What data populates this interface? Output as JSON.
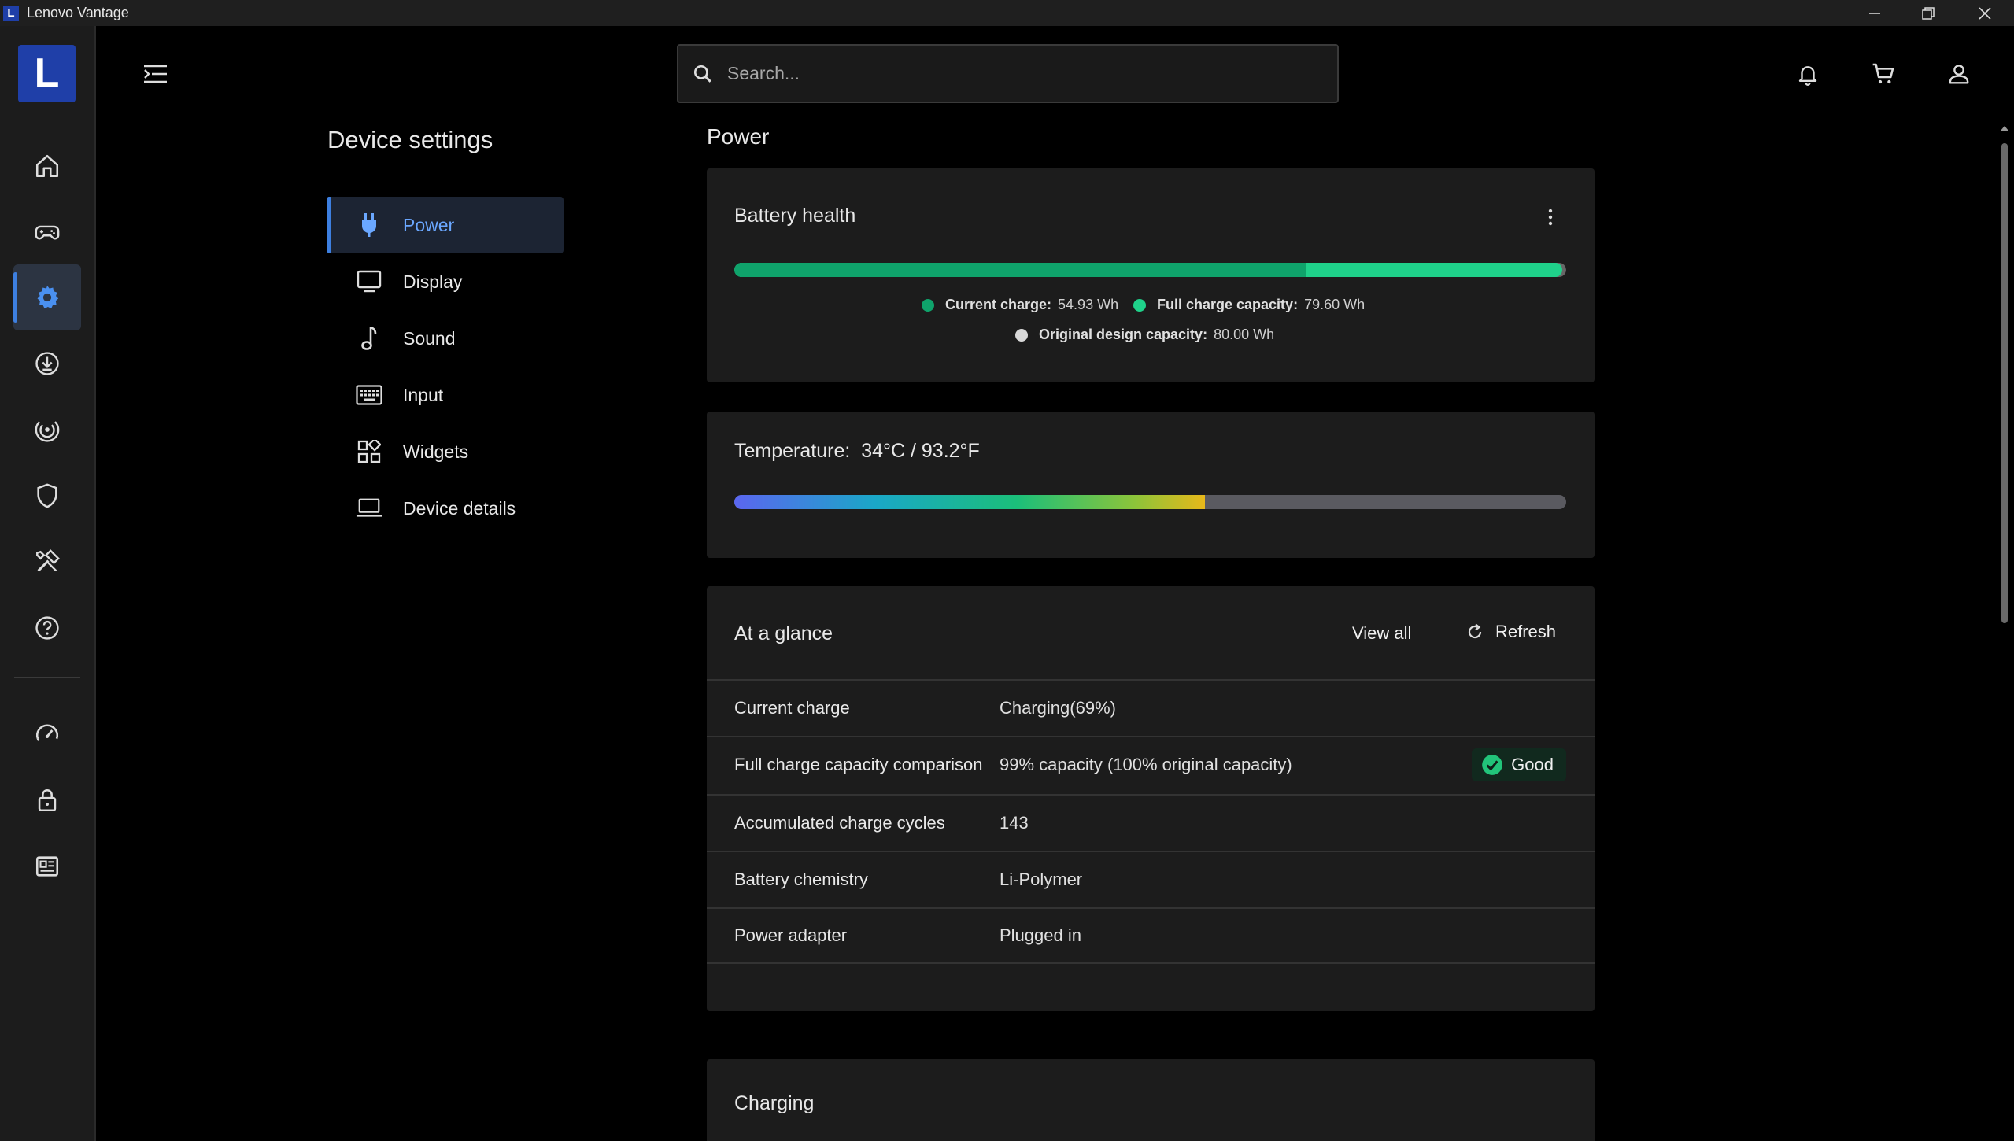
{
  "window": {
    "title": "Lenovo Vantage",
    "logo_letter": "L",
    "controls": [
      "minimize-icon",
      "restore-icon",
      "close-icon"
    ]
  },
  "rail": {
    "logo_letter": "L",
    "items": [
      {
        "name": "home-icon",
        "active": false
      },
      {
        "name": "gamepad-icon",
        "active": false
      },
      {
        "name": "gear-icon",
        "active": true
      },
      {
        "name": "download-icon",
        "active": false
      },
      {
        "name": "signal-icon",
        "active": false
      },
      {
        "name": "shield-icon",
        "active": false
      },
      {
        "name": "tools-icon",
        "active": false
      },
      {
        "name": "help-icon",
        "active": false
      },
      {
        "name": "speedometer-icon",
        "active": false
      },
      {
        "name": "lock-icon",
        "active": false
      },
      {
        "name": "news-icon",
        "active": false
      }
    ]
  },
  "header": {
    "search_placeholder": "Search...",
    "icons": [
      "bell-icon",
      "cart-icon",
      "user-icon"
    ]
  },
  "settings_nav": {
    "title": "Device settings",
    "items": [
      {
        "label": "Power",
        "icon": "plug-icon",
        "active": true
      },
      {
        "label": "Display",
        "icon": "monitor-icon",
        "active": false
      },
      {
        "label": "Sound",
        "icon": "music-note-icon",
        "active": false
      },
      {
        "label": "Input",
        "icon": "keyboard-icon",
        "active": false
      },
      {
        "label": "Widgets",
        "icon": "widgets-icon",
        "active": false
      },
      {
        "label": "Device details",
        "icon": "laptop-icon",
        "active": false
      }
    ]
  },
  "page": {
    "title": "Power",
    "battery_health": {
      "title": "Battery health",
      "current_charge_label": "Current charge:",
      "current_charge_value": "54.93 Wh",
      "full_capacity_label": "Full charge capacity:",
      "full_capacity_value": "79.60 Wh",
      "design_capacity_label": "Original design capacity:",
      "design_capacity_value": "80.00 Wh",
      "current_charge_wh": 54.93,
      "full_capacity_wh": 79.6,
      "design_capacity_wh": 80.0,
      "colors": {
        "current": "#0fa36b",
        "full": "#1fd18a",
        "design": "#d8d8d8"
      }
    },
    "temperature": {
      "label": "Temperature:",
      "value": "34°C / 93.2°F",
      "fill_fraction": 0.566
    },
    "at_a_glance": {
      "title": "At a glance",
      "view_all": "View all",
      "refresh": "Refresh",
      "rows": [
        {
          "label": "Current charge",
          "value": "Charging(69%)",
          "badge": null
        },
        {
          "label": "Full charge capacity comparison",
          "value": "99% capacity (100% original capacity)",
          "badge": "Good"
        },
        {
          "label": "Accumulated charge cycles",
          "value": "143",
          "badge": null
        },
        {
          "label": "Battery chemistry",
          "value": "Li-Polymer",
          "badge": null
        },
        {
          "label": "Power adapter",
          "value": "Plugged in",
          "badge": null
        }
      ]
    },
    "charging": {
      "title": "Charging"
    }
  }
}
